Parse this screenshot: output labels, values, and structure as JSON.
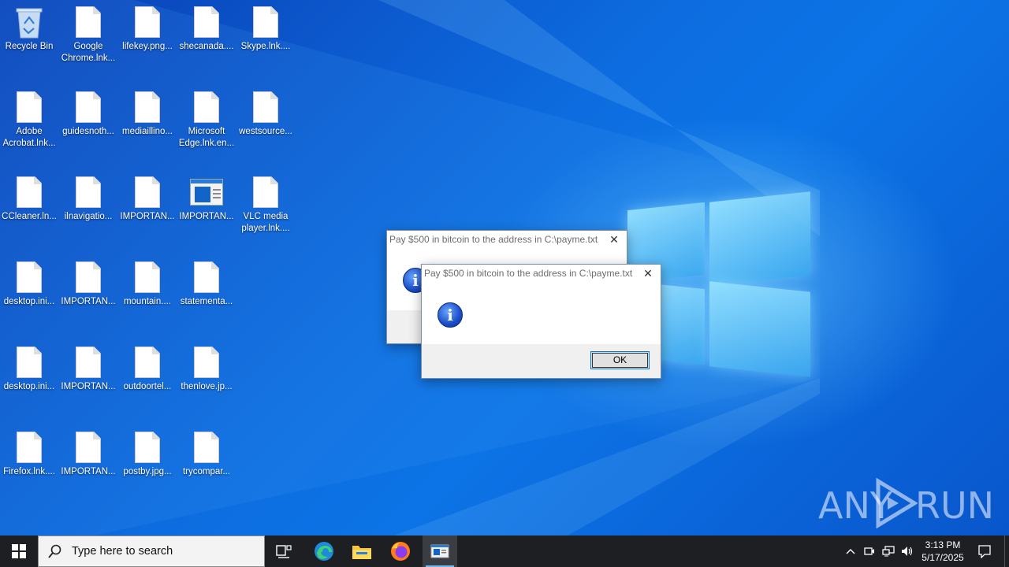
{
  "desktop": {
    "icons": [
      {
        "label": "Recycle Bin",
        "type": "recycle-bin"
      },
      {
        "label": "Google Chrome.lnk...",
        "type": "file"
      },
      {
        "label": "lifekey.png...",
        "type": "file"
      },
      {
        "label": "shecanada....",
        "type": "file"
      },
      {
        "label": "Skype.lnk....",
        "type": "file"
      },
      {
        "label": "Adobe Acrobat.lnk...",
        "type": "file"
      },
      {
        "label": "guidesnoth...",
        "type": "file"
      },
      {
        "label": "mediaillino...",
        "type": "file"
      },
      {
        "label": "Microsoft Edge.lnk.en...",
        "type": "file"
      },
      {
        "label": "westsource...",
        "type": "file"
      },
      {
        "label": "CCleaner.ln...",
        "type": "file"
      },
      {
        "label": "ilnavigatio...",
        "type": "file"
      },
      {
        "label": "IMPORTAN...",
        "type": "file"
      },
      {
        "label": "IMPORTAN...",
        "type": "app-window"
      },
      {
        "label": "VLC media player.lnk....",
        "type": "file"
      },
      {
        "label": "desktop.ini...",
        "type": "file"
      },
      {
        "label": "IMPORTAN...",
        "type": "file"
      },
      {
        "label": "mountain....",
        "type": "file"
      },
      {
        "label": "statementa...",
        "type": "file"
      },
      {
        "label": "desktop.ini...",
        "type": "file"
      },
      {
        "label": "IMPORTAN...",
        "type": "file"
      },
      {
        "label": "outdoortel...",
        "type": "file"
      },
      {
        "label": "thenlove.jp...",
        "type": "file"
      },
      {
        "label": "Firefox.lnk....",
        "type": "file"
      },
      {
        "label": "IMPORTAN...",
        "type": "file"
      },
      {
        "label": "postby.jpg...",
        "type": "file"
      },
      {
        "label": "trycompar...",
        "type": "file"
      }
    ]
  },
  "dialogs": {
    "back": {
      "title": "Pay $500 in bitcoin to the address in C:\\payme.txt",
      "close": "✕"
    },
    "front": {
      "title": "Pay $500 in bitcoin to the address in C:\\payme.txt",
      "close": "✕",
      "ok_label": "OK"
    }
  },
  "watermark": {
    "left": "ANY",
    "right": "RUN"
  },
  "taskbar": {
    "search_placeholder": "Type here to search",
    "time": "3:13 PM",
    "date": "5/17/2025",
    "pinned": [
      "task-view",
      "edge",
      "file-explorer",
      "firefox",
      "active-app"
    ]
  },
  "colors": {
    "taskbar_bg": "#1d1f23",
    "accent": "#0078d7",
    "wallpaper": "#0c74e6"
  }
}
